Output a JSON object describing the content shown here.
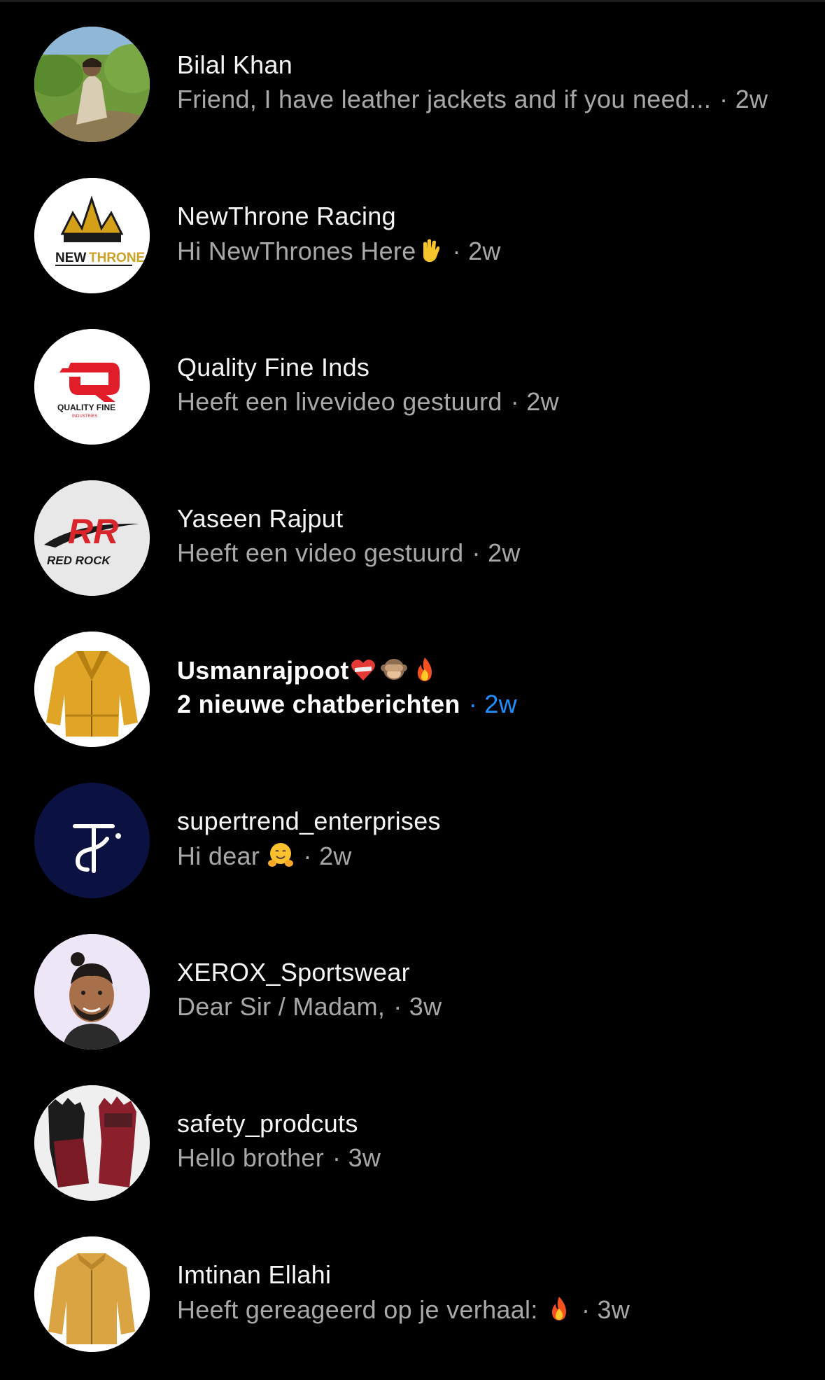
{
  "conversations": [
    {
      "name": "Bilal Khan",
      "message": "Friend, I have leather jackets and if you need...",
      "separator": "·",
      "time": "2w",
      "unread": false,
      "avatar_icon": "portrait-outdoor-photo"
    },
    {
      "name": "NewThrone Racing",
      "message": "Hi NewThrones Here",
      "message_emoji": "raised-hand-emoji",
      "separator": "·",
      "time": "2w",
      "unread": false,
      "avatar_icon": "newthrone-logo",
      "logo_text": [
        "NEW",
        "THRONE"
      ]
    },
    {
      "name": "Quality Fine Inds",
      "message": "Heeft een livevideo gestuurd",
      "separator": "·",
      "time": "2w",
      "unread": false,
      "avatar_icon": "quality-fine-logo",
      "logo_text": [
        "QUALITY FINE",
        "INDUSTRIES"
      ]
    },
    {
      "name": "Yaseen Rajput",
      "message": "Heeft een video gestuurd",
      "separator": "·",
      "time": "2w",
      "unread": false,
      "avatar_icon": "red-rock-logo",
      "logo_text": [
        "RR",
        "RED ROCK"
      ]
    },
    {
      "name": "Usmanrajpoot",
      "name_emojis": [
        "mending-heart-emoji",
        "see-no-evil-monkey-emoji",
        "fire-emoji"
      ],
      "message": "2 nieuwe chatberichten",
      "separator": "·",
      "time": "2w",
      "unread": true,
      "avatar_icon": "yellow-jacket-photo"
    },
    {
      "name": "supertrend_enterprises",
      "message": "Hi dear",
      "message_emoji": "hugging-face-emoji",
      "separator": "·",
      "time": "2w",
      "unread": false,
      "avatar_icon": "supertrend-logo"
    },
    {
      "name": "XEROX_Sportswear",
      "message": "Dear Sir / Madam,",
      "separator": "·",
      "time": "3w",
      "unread": false,
      "avatar_icon": "memoji-avatar"
    },
    {
      "name": "safety_prodcuts",
      "message": "Hello brother",
      "separator": "·",
      "time": "3w",
      "unread": false,
      "avatar_icon": "gloves-photo"
    },
    {
      "name": "Imtinan Ellahi",
      "message": "Heeft gereageerd op je verhaal:",
      "message_emoji": "fire-emoji",
      "separator": "·",
      "time": "3w",
      "unread": false,
      "avatar_icon": "tan-jacket-photo"
    }
  ],
  "colors": {
    "background": "#000000",
    "name_text": "#f5f5f5",
    "secondary_text": "#a8a8a8",
    "unread_time": "#1f8fff"
  }
}
